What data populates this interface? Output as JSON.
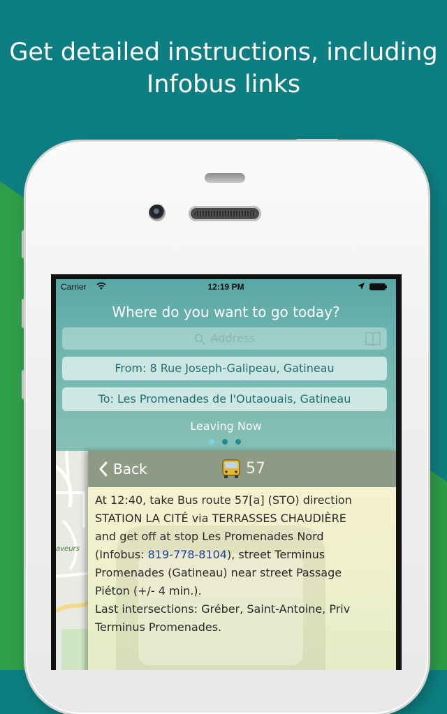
{
  "headline": {
    "line1": "Get detailed instructions, including",
    "line2": "Infobus links"
  },
  "colors": {
    "teal_background": "#0d7f82",
    "green_accent": "#2e9e49",
    "panel_teal": "#6fb5b0",
    "link_blue": "#1a3f9e"
  },
  "status_bar": {
    "carrier": "Carrier",
    "time": "12:19 PM",
    "icons": [
      "wifi-icon",
      "location-arrow-icon",
      "battery-icon"
    ]
  },
  "planner": {
    "question": "Where do you want to go today?",
    "search_placeholder": "Address",
    "from_label": "From: 8 Rue Joseph-Galipeau, Gatineau",
    "to_label": "To: Les Promenades de l'Outaouais, Gatineau",
    "leaving_label": "Leaving Now",
    "page_count": 3
  },
  "map": {
    "label": "aveurs"
  },
  "detail": {
    "back_label": "Back",
    "route_number": "57",
    "instruction_part1": "At 12:40, take Bus route 57[a] (STO) direction\nSTATION LA CITÉ via TERRASSES CHAUDIÈRE\nand get off at stop Les Promenades Nord\n(Infobus: ",
    "infobus_phone": "819-778-8104",
    "instruction_part2": "), street Terminus\nPromenades (Gatineau) near street Passage\nPiéton (+/- 4 min.).\nLast intersections: Gréber, Saint-Antoine, Priv\nTerminus Promenades."
  }
}
